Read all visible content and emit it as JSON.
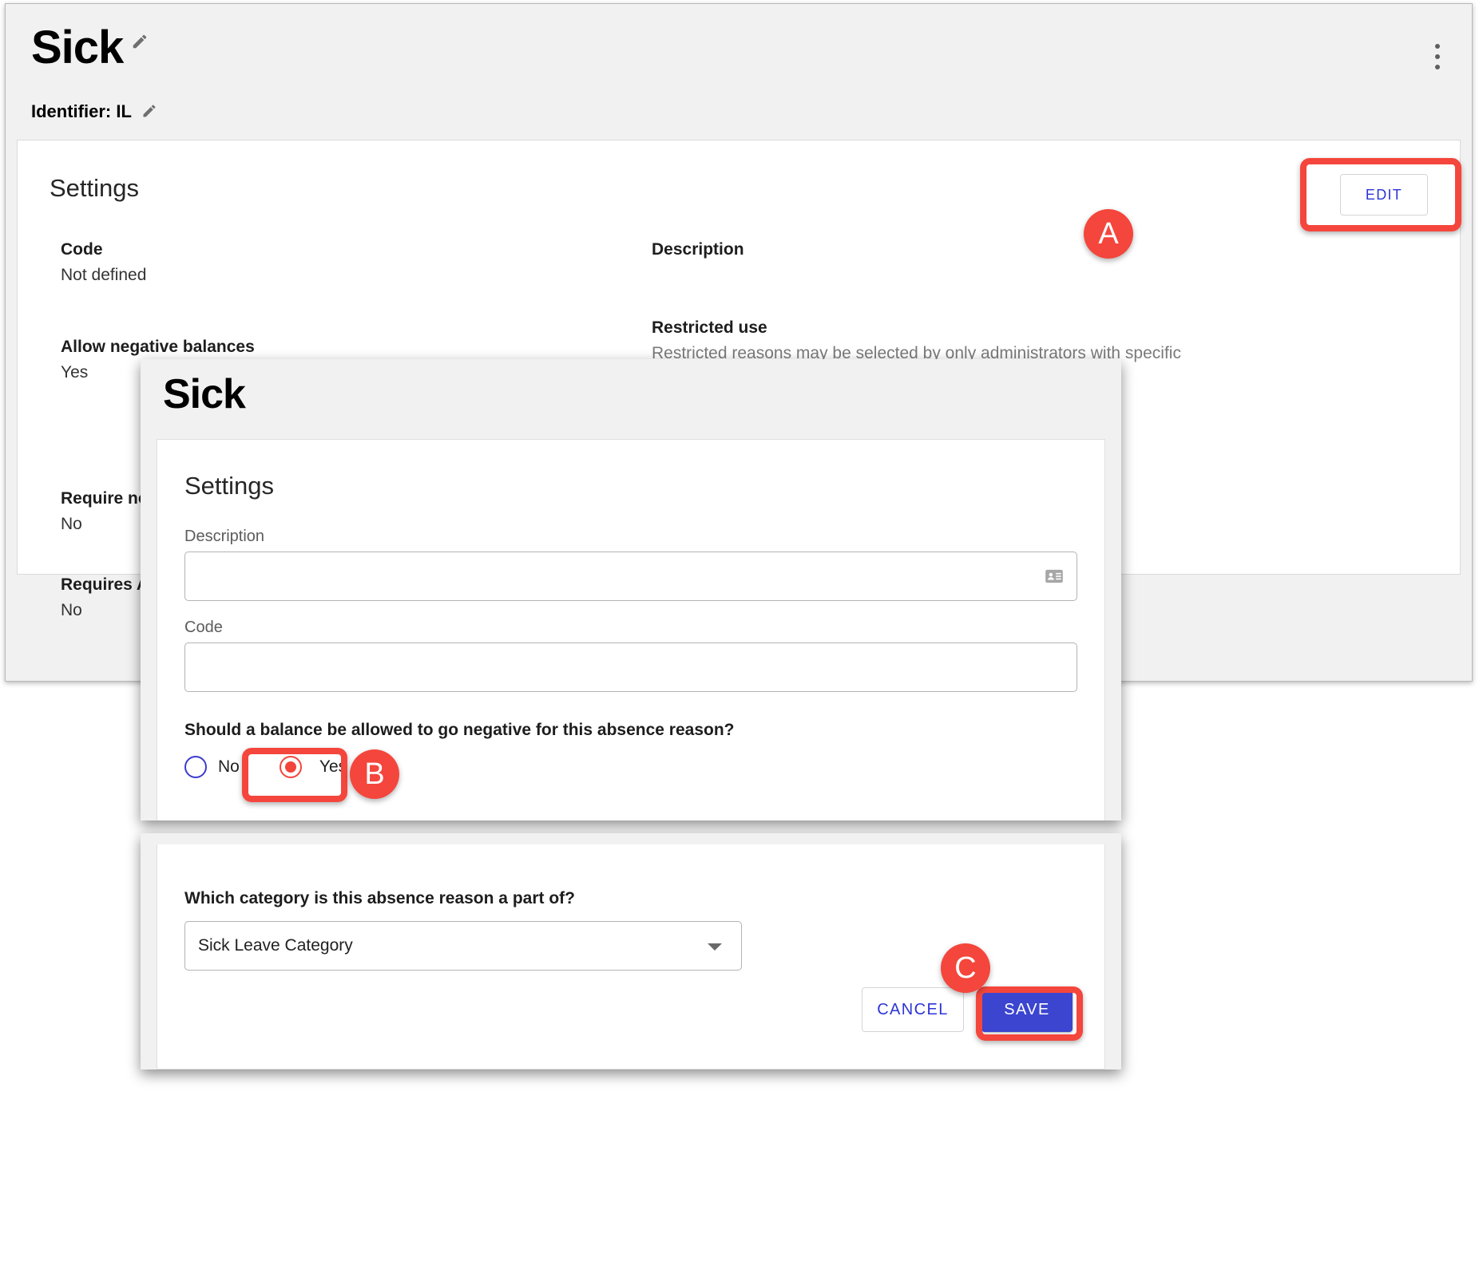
{
  "page": {
    "title": "Sick",
    "identifier_label": "Identifier: IL",
    "edit_icon": "pencil-icon",
    "overflow_icon": "kebab-menu-icon"
  },
  "settings_card": {
    "title": "Settings",
    "edit_button": "EDIT",
    "left_fields": [
      {
        "label": "Code",
        "value": "Not defined"
      },
      {
        "label": "Allow negative balances",
        "value": "Yes"
      },
      {
        "label": "Require not",
        "value": "No"
      },
      {
        "label": "Requires A",
        "value": "No"
      }
    ],
    "right_fields": [
      {
        "label": "Description",
        "value": ""
      },
      {
        "label": "Restricted use",
        "value": "Restricted reasons may be selected by only administrators with specific"
      }
    ]
  },
  "modal": {
    "title": "Sick",
    "section_title": "Settings",
    "description_label": "Description",
    "description_value": "",
    "description_icon": "contact-card-icon",
    "code_label": "Code",
    "code_value": "",
    "negative_question": "Should a balance be allowed to go negative for this absence reason?",
    "radio_no": "No",
    "radio_yes": "Yes",
    "selected_radio": "Yes",
    "category_question": "Which category is this absence reason a part of?",
    "category_value": "Sick Leave Category",
    "category_caret_icon": "chevron-down-icon",
    "cancel_button": "CANCEL",
    "save_button": "SAVE"
  },
  "annotations": {
    "a": "A",
    "b": "B",
    "c": "C"
  },
  "colors": {
    "accent_blue": "#3b45cf",
    "link_blue": "#2d35d6",
    "highlight_red": "#f4463c",
    "page_bg": "#f1f1f1",
    "muted_text": "#7a7a7a"
  }
}
